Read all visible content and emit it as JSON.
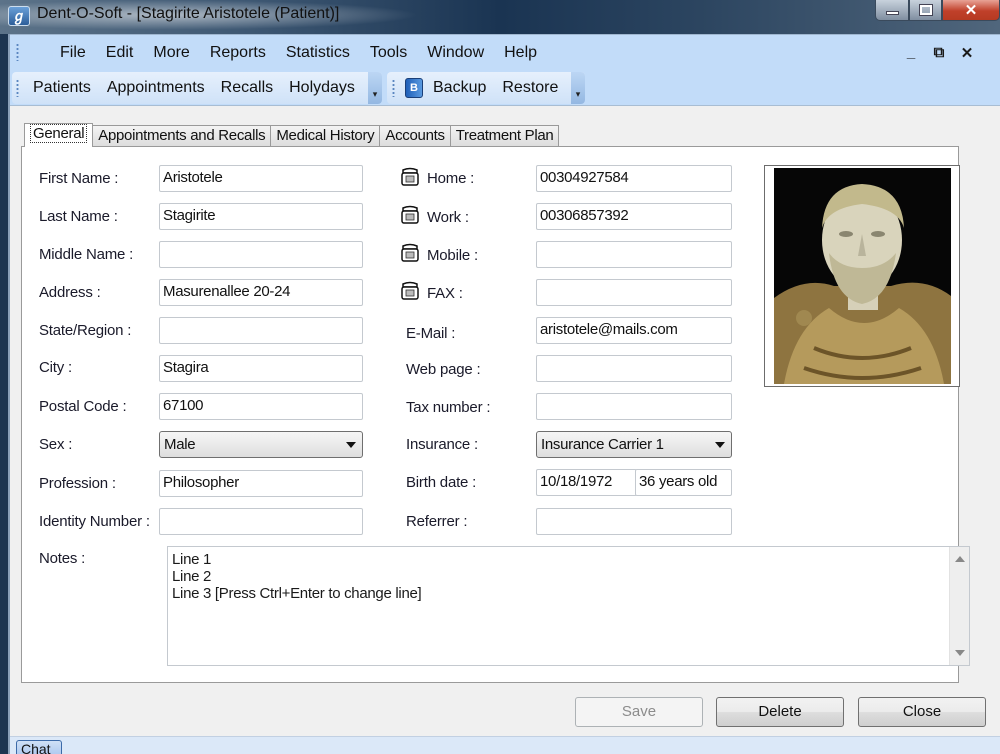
{
  "window": {
    "title": "Dent-O-Soft - [Stagirite Aristotele (Patient)]",
    "app_icon_glyph": "ℊ"
  },
  "menu": {
    "items": [
      "File",
      "Edit",
      "More",
      "Reports",
      "Statistics",
      "Tools",
      "Window",
      "Help"
    ],
    "mdi_minimize": "_",
    "mdi_restore": "⧉",
    "mdi_close": "✕"
  },
  "toolbar": {
    "main_items": [
      "Patients",
      "Appointments",
      "Recalls",
      "Holydays"
    ],
    "backup_label": "Backup",
    "restore_label": "Restore",
    "overflow_glyph": "▾"
  },
  "tabs": [
    "General",
    "Appointments and Recalls",
    "Medical History",
    "Accounts",
    "Treatment Plan"
  ],
  "active_tab": "General",
  "form": {
    "left": [
      {
        "label": "First Name :",
        "value": "Aristotele"
      },
      {
        "label": "Last Name :",
        "value": "Stagirite"
      },
      {
        "label": "Middle Name :",
        "value": ""
      },
      {
        "label": "Address :",
        "value": "Masurenallee 20-24"
      },
      {
        "label": "State/Region :",
        "value": ""
      },
      {
        "label": "City :",
        "value": "Stagira"
      },
      {
        "label": "Postal Code :",
        "value": "67100"
      },
      {
        "label": "Sex :",
        "value": "Male"
      },
      {
        "label": "Profession :",
        "value": "Philosopher"
      },
      {
        "label": "Identity Number :",
        "value": ""
      }
    ],
    "right": [
      {
        "label": "Home :",
        "value": "00304927584",
        "icon": "phone-icon"
      },
      {
        "label": "Work :",
        "value": "00306857392",
        "icon": "phone-icon"
      },
      {
        "label": "Mobile :",
        "value": "",
        "icon": "phone-icon"
      },
      {
        "label": "FAX :",
        "value": "",
        "icon": "phone-icon"
      },
      {
        "label": "E-Mail :",
        "value": "aristotele@mails.com"
      },
      {
        "label": "Web page :",
        "value": ""
      },
      {
        "label": "Tax number :",
        "value": ""
      },
      {
        "label": "Insurance :",
        "value": "Insurance Carrier 1"
      },
      {
        "label": "Birth date :",
        "value": "10/18/1972",
        "age": "36 years old"
      },
      {
        "label": "Referrer :",
        "value": ""
      }
    ],
    "notes_label": "Notes :",
    "notes_lines": [
      "Line 1",
      "Line 2",
      "Line 3 [Press Ctrl+Enter to change line]"
    ],
    "photo_alt": "Patient photo - bust of Aristotle"
  },
  "buttons": {
    "save": "Save",
    "delete": "Delete",
    "close": "Close"
  },
  "statusbar": {
    "chat": "Chat"
  },
  "colors": {
    "menubar_bg": "#c2dcf9",
    "titlebar_dark": "#1a3452",
    "close_red": "#c0402a"
  }
}
